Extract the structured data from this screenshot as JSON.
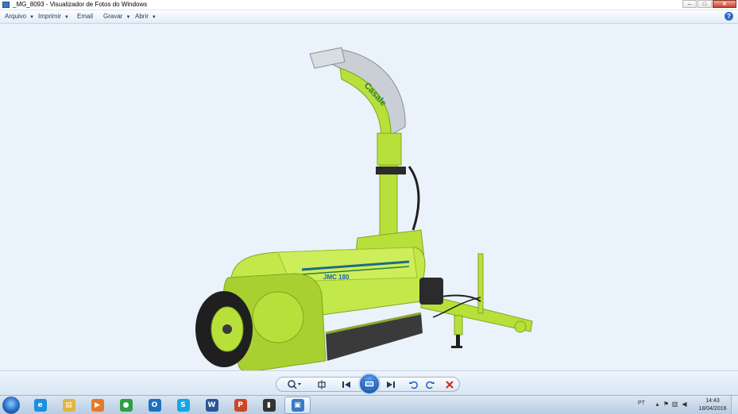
{
  "window": {
    "title": "_MG_8093 - Visualizador de Fotos do Windows",
    "controls": {
      "minimize": "–",
      "maximize": "□",
      "close": "✕"
    }
  },
  "menu": {
    "items": [
      {
        "label": "Arquivo",
        "has_dropdown": true
      },
      {
        "label": "Imprimir",
        "has_dropdown": true
      },
      {
        "label": "Email",
        "has_dropdown": false
      },
      {
        "label": "Gravar",
        "has_dropdown": true
      },
      {
        "label": "Abrir",
        "has_dropdown": true
      }
    ],
    "help_label": "?"
  },
  "photo": {
    "brand_text": "Casale",
    "model_text": "JMC 180"
  },
  "controls": {
    "zoom_icon": "zoom-icon",
    "fit_icon": "actual-size-icon",
    "previous_icon": "previous-icon",
    "slideshow_icon": "slideshow-icon",
    "next_icon": "next-icon",
    "rotate_ccw_icon": "rotate-left-icon",
    "rotate_cw_icon": "rotate-right-icon",
    "delete_icon": "delete-icon"
  },
  "taskbar": {
    "apps": [
      {
        "name": "internet-explorer",
        "glyph": "e",
        "color": "#1b8fe0"
      },
      {
        "name": "file-explorer",
        "glyph": "▤",
        "color": "#e2b441"
      },
      {
        "name": "media-player",
        "glyph": "▶",
        "color": "#e8792b"
      },
      {
        "name": "chrome",
        "glyph": "●",
        "color": "#2f9e44"
      },
      {
        "name": "outlook",
        "glyph": "O",
        "color": "#1e6fc2"
      },
      {
        "name": "skype",
        "glyph": "S",
        "color": "#14a7e8"
      },
      {
        "name": "word",
        "glyph": "W",
        "color": "#2a5699"
      },
      {
        "name": "powerpoint",
        "glyph": "P",
        "color": "#d04525"
      },
      {
        "name": "phone-app",
        "glyph": "▮",
        "color": "#333333"
      },
      {
        "name": "photo-viewer",
        "glyph": "▣",
        "color": "#3a7ac6"
      }
    ],
    "language": "PT",
    "time": "14:43",
    "date": "18/04/2016"
  },
  "colors": {
    "machine_green": "#b8e03a",
    "machine_shadow": "#7fa81e",
    "chute_metal": "#c9cfd4",
    "tire": "#1f1f1f",
    "accent_blue": "#1d5fb8"
  }
}
